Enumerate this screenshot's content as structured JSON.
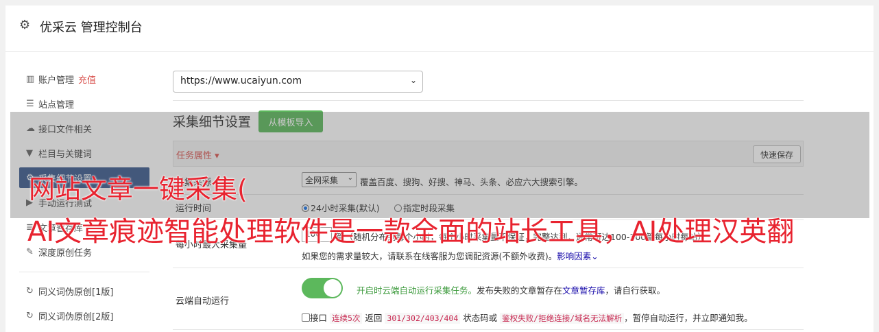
{
  "header": {
    "title": "优采云 管理控制台",
    "icon": "gear-icon"
  },
  "sidebar": {
    "items": [
      {
        "label": "账户管理",
        "extra": "充值",
        "icon": "bar-chart-icon"
      },
      {
        "label": "站点管理",
        "icon": "server-icon"
      },
      {
        "label": "接口文件相关",
        "icon": "cloud-upload-icon"
      },
      {
        "label": "栏目与关键词",
        "icon": "filter-icon"
      },
      {
        "label": "采集细节设置",
        "icon": "gear-icon",
        "active": true
      },
      {
        "label": "手动运行测试",
        "icon": "play-circle-icon"
      },
      {
        "label": "文章暂存库",
        "icon": "list-icon"
      },
      {
        "label": "深度原创任务",
        "icon": "edit-icon"
      },
      {
        "label": "同义词伪原创[1版]",
        "icon": "refresh-icon"
      },
      {
        "label": "同义词伪原创[2版]",
        "icon": "refresh-icon"
      }
    ]
  },
  "site_select": {
    "value": "https://www.ucaiyun.com"
  },
  "section": {
    "title": "采集细节设置",
    "template_button": "从模板导入"
  },
  "task_attr": {
    "label": "任务属性 ▾",
    "save_button": "快速保存"
  },
  "rows": {
    "source": {
      "label": "采集来源",
      "select_value": "全网采集",
      "desc": "覆盖百度、搜狗、好搜、神马、头条、必应六大搜索引擎。"
    },
    "run_time": {
      "label": "运行时间",
      "option1": "24小时采集(默认)",
      "option2": "指定时段采集"
    },
    "max_per_hour": {
      "label": "每小时最大采集量",
      "value": "100",
      "line1": "篇（随机分布到每个小时，每个小时采集量不保证，完整达到，通常可达100-300篇每小时每站）",
      "line2_prefix": "如果您的需求量较大，请联系在线客服为您调配资源(不额外收费)。",
      "line2_link": "影响因素"
    },
    "cloud_run": {
      "label": "云端自动运行",
      "enabled_text": "开启时云端自动运行采集任务。",
      "desc_prefix": "发布失败的文章暂存在",
      "desc_link": "文章暂存库",
      "desc_suffix": "，请自行获取。",
      "check_prefix": "接口",
      "code1": "连续5次",
      "mid1": "返回",
      "code2": "301/302/403/404",
      "mid2": "状态码或",
      "code3": "鉴权失败/拒绝连接/域名无法解析",
      "tail": "，暂停自动运行，并立即通知我。"
    }
  },
  "overlay": {
    "line1": "网站文章一键采集(",
    "line2": "AI文章痕迹智能处理软件是一款全面的站长工具，AI处理汉英翻"
  },
  "colors": {
    "accent_green": "#5cb85c",
    "active_nav": "#3c5b8e",
    "danger": "#d9534f",
    "overlay_text": "#e8232f"
  }
}
